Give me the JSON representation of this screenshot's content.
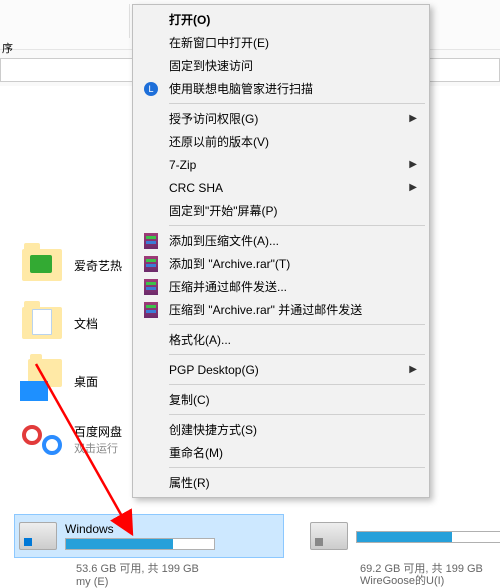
{
  "toolbar": {
    "ribbon_label": "序"
  },
  "items": {
    "iqiyi": "爱奇艺热",
    "documents": "文档",
    "desktop": "桌面",
    "baidu": "百度网盘",
    "baidu_sub": "双击运行"
  },
  "drives": {
    "c": {
      "name": "Windows",
      "status": "53.6 GB 可用, 共 199 GB",
      "below": "my (E)"
    },
    "d": {
      "status": "69.2 GB 可用, 共 199 GB",
      "below": "WireGoose的U(I)"
    }
  },
  "menu": {
    "open": "打开(O)",
    "open_new_window": "在新窗口中打开(E)",
    "pin_quick_access": "固定到快速访问",
    "lenovo_scan": "使用联想电脑管家进行扫描",
    "grant_access": "授予访问权限(G)",
    "restore_previous": "还原以前的版本(V)",
    "seven_zip": "7-Zip",
    "crc_sha": "CRC SHA",
    "pin_start": "固定到\"开始\"屏幕(P)",
    "add_archive": "添加到压缩文件(A)...",
    "add_archive_named": "添加到 \"Archive.rar\"(T)",
    "compress_email": "压缩并通过邮件发送...",
    "compress_named_email": "压缩到 \"Archive.rar\" 并通过邮件发送",
    "format": "格式化(A)...",
    "pgp_desktop": "PGP Desktop(G)",
    "copy": "复制(C)",
    "create_shortcut": "创建快捷方式(S)",
    "rename": "重命名(M)",
    "properties": "属性(R)"
  },
  "glyphs": {
    "submenu_arrow": "▶",
    "lenovo_letter": "L"
  }
}
